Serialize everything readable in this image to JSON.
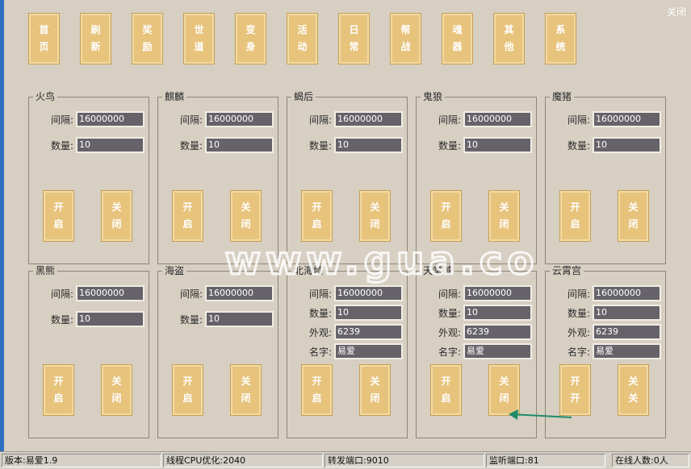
{
  "window": {
    "close_label": "关闭"
  },
  "toolbar": [
    {
      "l1": "首",
      "l2": "页"
    },
    {
      "l1": "刷",
      "l2": "新"
    },
    {
      "l1": "奖",
      "l2": "励"
    },
    {
      "l1": "世",
      "l2": "道"
    },
    {
      "l1": "变",
      "l2": "身"
    },
    {
      "l1": "活",
      "l2": "动"
    },
    {
      "l1": "日",
      "l2": "常"
    },
    {
      "l1": "帮",
      "l2": "战"
    },
    {
      "l1": "魂",
      "l2": "器"
    },
    {
      "l1": "其",
      "l2": "他"
    },
    {
      "l1": "系",
      "l2": "统"
    }
  ],
  "labels": {
    "interval": "间隔:",
    "count": "数量:",
    "look": "外观:",
    "name": "名字:"
  },
  "groups": [
    {
      "title": "火鸟",
      "interval": "16000000",
      "count": "10",
      "open": [
        "开",
        "启"
      ],
      "close": [
        "关",
        "闭"
      ]
    },
    {
      "title": "麒麟",
      "interval": "16000000",
      "count": "10",
      "open": [
        "开",
        "启"
      ],
      "close": [
        "关",
        "闭"
      ]
    },
    {
      "title": "蝎后",
      "interval": "16000000",
      "count": "10",
      "open": [
        "开",
        "启"
      ],
      "close": [
        "关",
        "闭"
      ]
    },
    {
      "title": "鬼狼",
      "interval": "16000000",
      "count": "10",
      "open": [
        "开",
        "启"
      ],
      "close": [
        "关",
        "闭"
      ]
    },
    {
      "title": "魔猪",
      "interval": "16000000",
      "count": "10",
      "open": [
        "开",
        "启"
      ],
      "close": [
        "关",
        "闭"
      ]
    },
    {
      "title": "黑熊",
      "interval": "16000000",
      "count": "10",
      "open": [
        "开",
        "启"
      ],
      "close": [
        "关",
        "闭"
      ]
    },
    {
      "title": "海盗",
      "interval": "16000000",
      "count": "10",
      "open": [
        "开",
        "启"
      ],
      "close": [
        "关",
        "闭"
      ]
    },
    {
      "title": "北海域",
      "interval": "16000000",
      "count": "10",
      "look": "6239",
      "name": "易爱",
      "open": [
        "开",
        "启"
      ],
      "close": [
        "关",
        "闭"
      ]
    },
    {
      "title": "天堂域",
      "interval": "16000000",
      "count": "10",
      "look": "6239",
      "name": "易爱",
      "open": [
        "开",
        "启"
      ],
      "close": [
        "关",
        "闭"
      ]
    },
    {
      "title": "云霄宫",
      "interval": "16000000",
      "count": "10",
      "look": "6239",
      "name": "易爱",
      "open": [
        "开",
        "开"
      ],
      "close": [
        "关",
        "关"
      ]
    }
  ],
  "status": {
    "version": "版本:易爱1.9",
    "cpu": "线程CPU优化:2040",
    "forward_port": "转发端口:9010",
    "listen_port": "监听端口:81",
    "online": "在线人数:0人"
  },
  "watermark": "www.gua.co"
}
